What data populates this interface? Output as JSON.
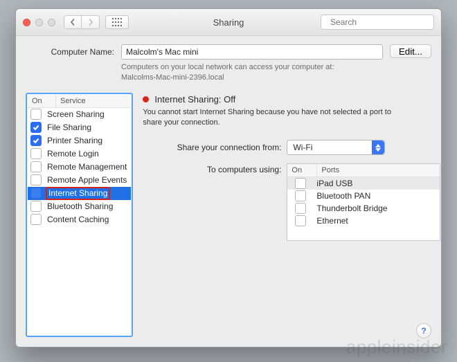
{
  "window": {
    "title": "Sharing",
    "search_placeholder": "Search"
  },
  "name": {
    "label": "Computer Name:",
    "value": "Malcolm's Mac mini",
    "hint_line1": "Computers on your local network can access your computer at:",
    "hint_line2": "Malcolms-Mac-mini-2396.local",
    "edit_label": "Edit..."
  },
  "services": {
    "columns": {
      "on": "On",
      "service": "Service"
    },
    "rows": [
      {
        "on": false,
        "label": "Screen Sharing",
        "selected": false
      },
      {
        "on": true,
        "label": "File Sharing",
        "selected": false
      },
      {
        "on": true,
        "label": "Printer Sharing",
        "selected": false
      },
      {
        "on": false,
        "label": "Remote Login",
        "selected": false
      },
      {
        "on": false,
        "label": "Remote Management",
        "selected": false
      },
      {
        "on": false,
        "label": "Remote Apple Events",
        "selected": false
      },
      {
        "on": false,
        "label": "Internet Sharing",
        "selected": true,
        "highlight": true
      },
      {
        "on": false,
        "label": "Bluetooth Sharing",
        "selected": false
      },
      {
        "on": false,
        "label": "Content Caching",
        "selected": false
      }
    ]
  },
  "detail": {
    "status_color": "#d7261d",
    "status_text": "Internet Sharing: Off",
    "explain": "You cannot start Internet Sharing because you have not selected a port to share your connection.",
    "share_from_label": "Share your connection from:",
    "share_from_value": "Wi-Fi",
    "to_label": "To computers using:",
    "ports_columns": {
      "on": "On",
      "ports": "Ports"
    },
    "ports": [
      {
        "on": false,
        "label": "iPad USB",
        "selected": true
      },
      {
        "on": false,
        "label": "Bluetooth PAN"
      },
      {
        "on": false,
        "label": "Thunderbolt Bridge"
      },
      {
        "on": false,
        "label": "Ethernet"
      }
    ]
  },
  "watermark": "appleinsider"
}
